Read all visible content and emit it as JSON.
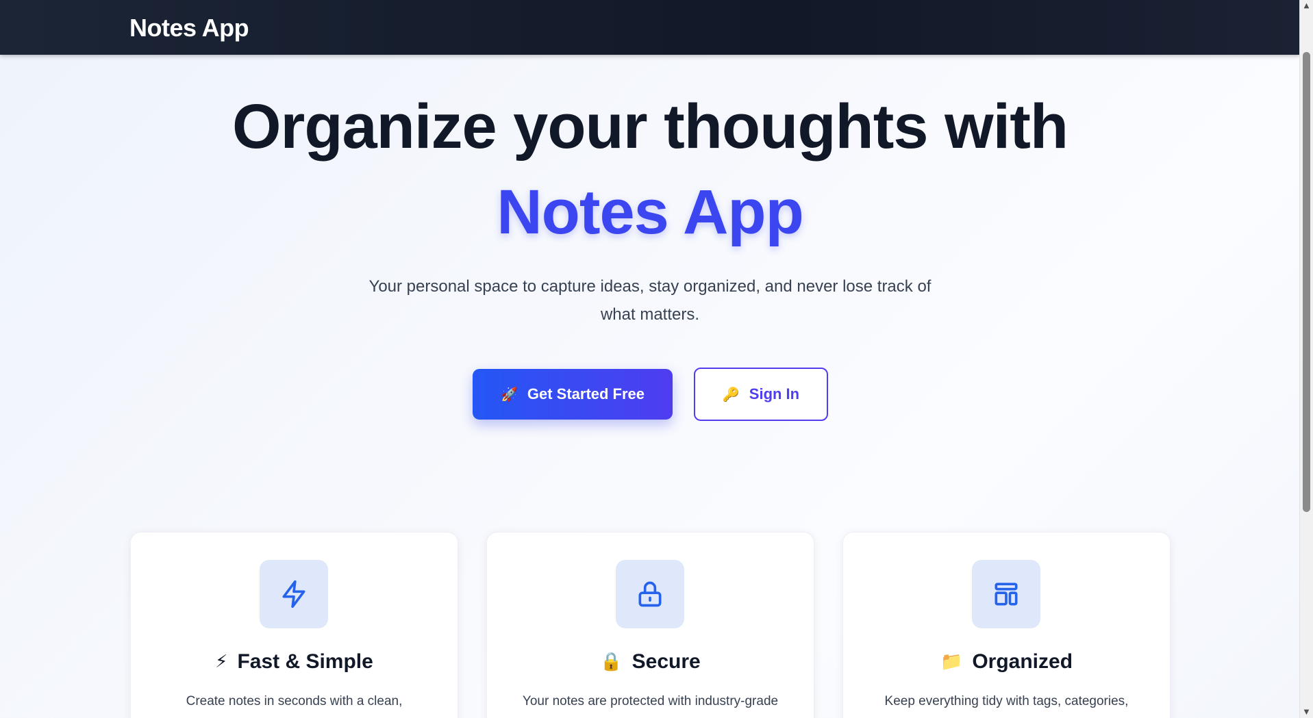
{
  "navbar": {
    "brand": "Notes App"
  },
  "hero": {
    "headline": "Organize your thoughts with",
    "headline_accent": "Notes App",
    "subtitle": "Your personal space to capture ideas, stay organized, and never lose track of what matters.",
    "primary_button": {
      "icon": "🚀",
      "icon_name": "rocket-icon",
      "label": "Get Started Free"
    },
    "secondary_button": {
      "icon": "🔑",
      "icon_name": "key-icon",
      "label": "Sign In"
    }
  },
  "features": [
    {
      "icon_name": "lightning-icon",
      "emoji": "⚡",
      "title": "Fast & Simple",
      "description": "Create notes in seconds with a clean,"
    },
    {
      "icon_name": "lock-icon",
      "emoji": "🔒",
      "title": "Secure",
      "description": "Your notes are protected with industry-grade"
    },
    {
      "icon_name": "layout-icon",
      "emoji": "📁",
      "title": "Organized",
      "description": "Keep everything tidy with tags, categories,"
    }
  ],
  "colors": {
    "navbar_bg": "#111827",
    "accent": "#3b46f1",
    "primary_gradient_start": "#2457f5",
    "primary_gradient_end": "#4f3df0",
    "icon_stroke": "#2563eb",
    "icon_box_bg": "#dfe7fb"
  }
}
